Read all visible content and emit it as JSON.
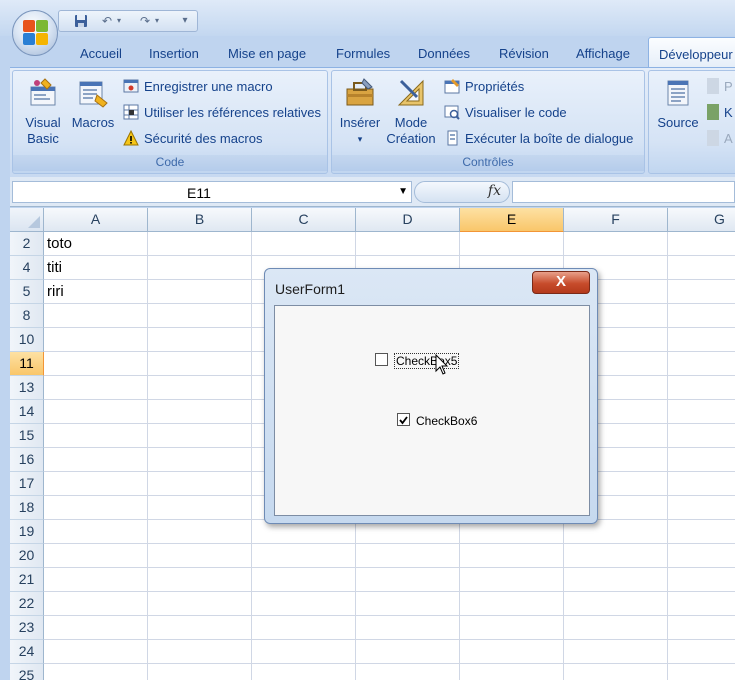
{
  "qat": {
    "icons": [
      "save-icon",
      "undo-icon",
      "redo-icon",
      "customize-icon"
    ]
  },
  "tabs": [
    "Accueil",
    "Insertion",
    "Mise en page",
    "Formules",
    "Données",
    "Révision",
    "Affichage",
    "Développeur"
  ],
  "ribbon": {
    "code": {
      "label": "Code",
      "visual_basic": [
        "Visual",
        "Basic"
      ],
      "macros": "Macros",
      "record_macro": "Enregistrer une macro",
      "relative_refs": "Utiliser les références relatives",
      "macro_security": "Sécurité des macros"
    },
    "controls": {
      "label": "Contrôles",
      "insert": "Insérer",
      "design_mode": [
        "Mode",
        "Création"
      ],
      "properties": "Propriétés",
      "view_code": "Visualiser le code",
      "run_dialog": "Exécuter la boîte de dialogue"
    },
    "xml": {
      "source": "Source",
      "partial": [
        "P",
        "K",
        "A"
      ]
    }
  },
  "formula_bar": {
    "name_box": "E11",
    "fx": "fx",
    "formula": ""
  },
  "sheet": {
    "columns": [
      "A",
      "B",
      "C",
      "D",
      "E",
      "F",
      "G"
    ],
    "selected_column": "E",
    "rows": [
      "2",
      "4",
      "5",
      "8",
      "10",
      "11",
      "13",
      "14",
      "15",
      "16",
      "17",
      "18",
      "19",
      "20",
      "21",
      "22",
      "23",
      "24",
      "25"
    ],
    "selected_row": "11",
    "cells_a": [
      "toto",
      "titi",
      "riri"
    ]
  },
  "userform": {
    "title": "UserForm1",
    "close": "X",
    "checkbox5": {
      "label": "CheckBox5",
      "checked": false
    },
    "checkbox6": {
      "label": "CheckBox6",
      "checked": true
    }
  }
}
